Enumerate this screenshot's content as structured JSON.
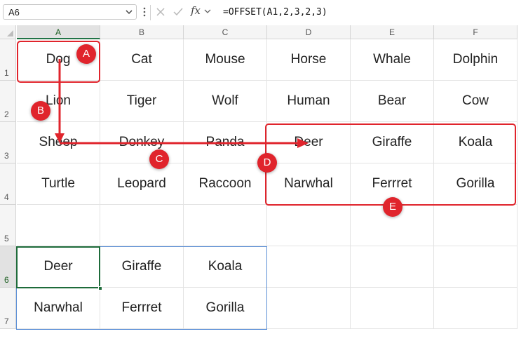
{
  "name_box": {
    "value": "A6"
  },
  "formula_bar": {
    "fx_label": "fx",
    "formula": "=OFFSET(A1,2,3,2,3)"
  },
  "columns": [
    "A",
    "B",
    "C",
    "D",
    "E",
    "F"
  ],
  "rows": [
    "1",
    "2",
    "3",
    "4",
    "5",
    "6",
    "7"
  ],
  "cells": [
    [
      "Dog",
      "Cat",
      "Mouse",
      "Horse",
      "Whale",
      "Dolphin"
    ],
    [
      "Lion",
      "Tiger",
      "Wolf",
      "Human",
      "Bear",
      "Cow"
    ],
    [
      "Sheep",
      "Donkey",
      "Panda",
      "Deer",
      "Giraffe",
      "Koala"
    ],
    [
      "Turtle",
      "Leopard",
      "Raccoon",
      "Narwhal",
      "Ferrret",
      "Gorilla"
    ],
    [
      "",
      "",
      "",
      "",
      "",
      ""
    ],
    [
      "Deer",
      "Giraffe",
      "Koala",
      "",
      "",
      ""
    ],
    [
      "Narwhal",
      "Ferrret",
      "Gorilla",
      "",
      "",
      ""
    ]
  ],
  "selection": {
    "active_cell": "A6",
    "spill_range": "A6:C7"
  },
  "annotations": {
    "color": "#e0242c",
    "badges": [
      "A",
      "B",
      "C",
      "D",
      "E"
    ]
  },
  "colors": {
    "selection_border": "#1e6b3a",
    "range_border": "#5b8fd6"
  }
}
